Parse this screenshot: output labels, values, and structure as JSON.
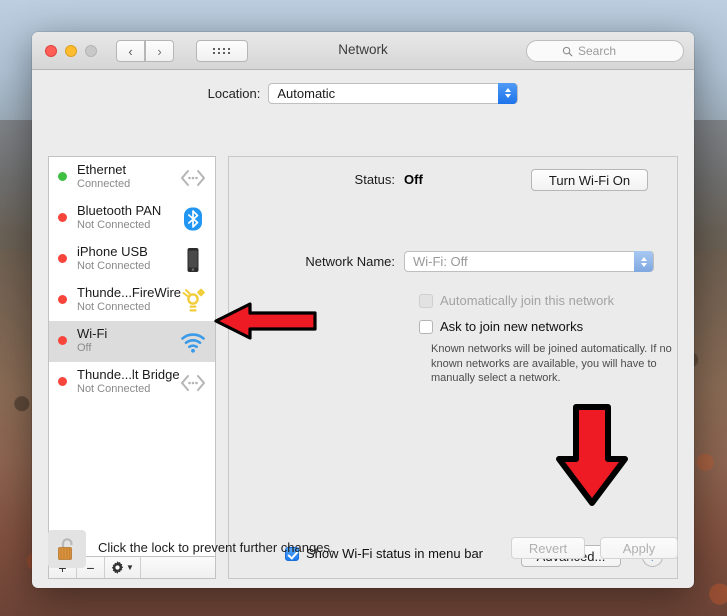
{
  "window": {
    "title": "Network",
    "traffic_lights": [
      "close",
      "minimize",
      "maximize"
    ],
    "nav_back_icon": "chevron-left-icon",
    "nav_forward_icon": "chevron-right-icon",
    "show_all_icon": "grid-dots-icon"
  },
  "search": {
    "placeholder": "Search",
    "value": "",
    "icon": "search-icon"
  },
  "location": {
    "label": "Location:",
    "value": "Automatic"
  },
  "sidebar": {
    "items": [
      {
        "name": "Ethernet",
        "status": "Connected",
        "dot": "green",
        "icon": "ethernet-icon",
        "selected": false
      },
      {
        "name": "Bluetooth PAN",
        "status": "Not Connected",
        "dot": "red",
        "icon": "bluetooth-icon",
        "selected": false
      },
      {
        "name": "iPhone USB",
        "status": "Not Connected",
        "dot": "red",
        "icon": "iphone-icon",
        "selected": false
      },
      {
        "name": "Thunde...FireWire",
        "status": "Not Connected",
        "dot": "red",
        "icon": "firewire-icon",
        "selected": false
      },
      {
        "name": "Wi-Fi",
        "status": "Off",
        "dot": "red",
        "icon": "wifi-icon",
        "selected": true
      },
      {
        "name": "Thunde...lt Bridge",
        "status": "Not Connected",
        "dot": "red",
        "icon": "ethernet-icon",
        "selected": false
      }
    ],
    "toolbar": {
      "add": "+",
      "remove": "−",
      "action_icon": "gear-icon",
      "action_chevron": "chevron-down-icon"
    }
  },
  "detail": {
    "status_label": "Status:",
    "status_value": "Off",
    "turn_wifi_on_label": "Turn Wi-Fi On",
    "network_name_label": "Network Name:",
    "network_name_value": "Wi-Fi: Off",
    "auto_join_label": "Automatically join this network",
    "auto_join_checked": false,
    "auto_join_disabled": true,
    "ask_join_label": "Ask to join new networks",
    "ask_join_checked": false,
    "join_help": "Known networks will be joined automatically. If no known networks are available, you will have to manually select a network.",
    "show_status_label": "Show Wi-Fi status in menu bar",
    "show_status_checked": true,
    "advanced_label": "Advanced...",
    "help_label": "?"
  },
  "bottom": {
    "lock_icon": "unlocked-padlock-icon",
    "lock_text": "Click the lock to prevent further changes.",
    "revert_label": "Revert",
    "apply_label": "Apply"
  },
  "annotations": [
    {
      "name": "arrow-pointing-at-wifi-row",
      "direction": "left",
      "color": "#ee1b24"
    },
    {
      "name": "arrow-pointing-at-advanced",
      "direction": "down",
      "color": "#ee1b24"
    }
  ],
  "colors": {
    "accent_blue": "#1a7af0",
    "status_connected": "#3fc043",
    "status_disconnected": "#f8453b",
    "annotation_red": "#ee1b24",
    "window_bg": "#ececec"
  }
}
